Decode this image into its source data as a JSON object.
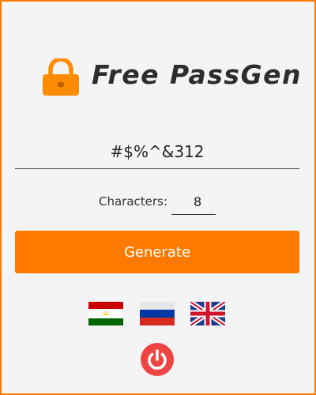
{
  "app": {
    "title": "Free PassGen",
    "accent_color": "#ff7a00",
    "icon": "padlock-icon"
  },
  "password": {
    "value": "#$%^&312"
  },
  "characters": {
    "label": "Characters:",
    "value": "8"
  },
  "generate": {
    "label": "Generate"
  },
  "languages": [
    {
      "name": "tajik-flag-icon"
    },
    {
      "name": "russian-flag-icon"
    },
    {
      "name": "uk-flag-icon"
    }
  ],
  "power": {
    "icon": "power-icon",
    "color": "#ef4444"
  }
}
